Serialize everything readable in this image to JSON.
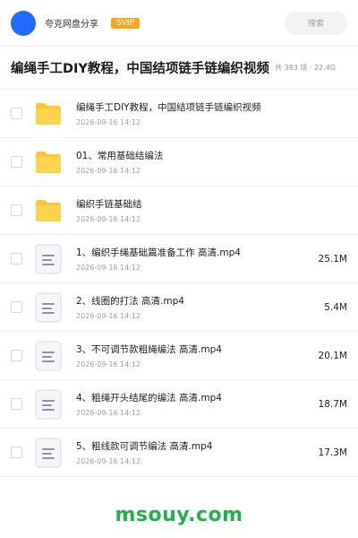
{
  "header": {
    "app_name": "夸克网盘分享",
    "badge": "SVIP",
    "search_placeholder": "搜索"
  },
  "title": "编绳手工DIY教程，中国结项链手链编织视频",
  "meta": "共 383 项 · 22.4G",
  "items": [
    {
      "type": "folder",
      "name": "编绳手工DIY教程，中国结项链手链编织视频",
      "date": "2026-09-16 14:12",
      "size": ""
    },
    {
      "type": "folder",
      "name": "01、常用基础结编法",
      "date": "2026-09-16 14:12",
      "size": ""
    },
    {
      "type": "folder",
      "name": "编织手链基础结",
      "date": "2026-09-16 14:12",
      "size": ""
    },
    {
      "type": "file",
      "name": "1、编织手绳基础篇准备工作 高清.mp4",
      "date": "2026-09-16 14:12",
      "size": "25.1M"
    },
    {
      "type": "file",
      "name": "2、线圈的打法 高清.mp4",
      "date": "2026-09-16 14:12",
      "size": "5.4M"
    },
    {
      "type": "file",
      "name": "3、不可调节款粗绳编法 高清.mp4",
      "date": "2026-09-16 14:12",
      "size": "20.1M"
    },
    {
      "type": "file",
      "name": "4、粗绳开头结尾的编法 高清.mp4",
      "date": "2026-09-16 14:12",
      "size": "18.7M"
    },
    {
      "type": "file",
      "name": "5、粗线款可调节编法 高清.mp4",
      "date": "2026-09-16 14:12",
      "size": "17.3M"
    }
  ],
  "footer_brand": "msouy.com",
  "colors": {
    "accent": "#1f6bff",
    "folder": "#ffc533",
    "svip": "#f6a623",
    "brand": "#22b14c"
  }
}
